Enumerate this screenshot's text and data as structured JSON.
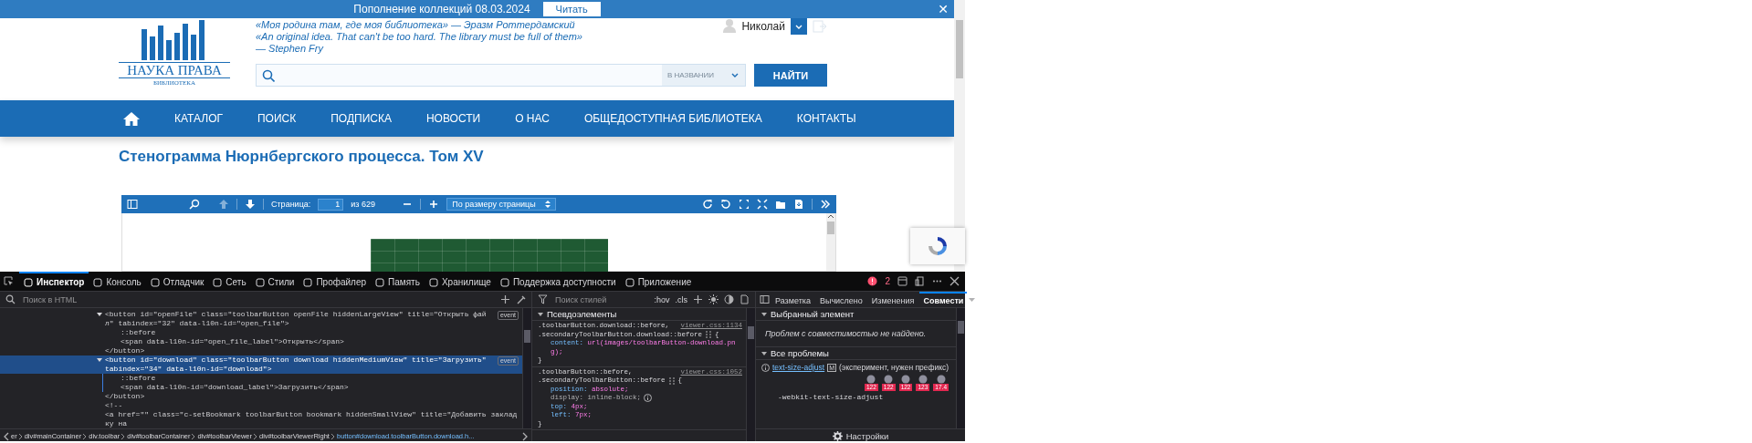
{
  "banner": {
    "text": "Пополнение коллекций 08.03.2024",
    "button": "Читать",
    "close": "✕"
  },
  "header": {
    "logo": {
      "title": "НАУКА ПРАВА",
      "subtitle": "БИБЛИОТЕКА"
    },
    "quotes": [
      "«Моя родина там, где моя библиотека» — Эразм Роттердамский",
      "«An original idea. That can't be too hard. The library must be full of them»",
      "— Stephen Fry"
    ],
    "user": {
      "name": "Николай"
    },
    "search": {
      "scope": "В НАЗВАНИИ",
      "button": "НАЙТИ"
    }
  },
  "nav": {
    "items": [
      {
        "kind": "home"
      },
      {
        "kind": "link",
        "label": "КАТАЛОГ"
      },
      {
        "kind": "link",
        "label": "ПОИСК"
      },
      {
        "kind": "link",
        "label": "ПОДПИСКА"
      },
      {
        "kind": "link",
        "label": "НОВОСТИ"
      },
      {
        "kind": "link",
        "label": "О НАС"
      },
      {
        "kind": "link",
        "label": "ОБЩЕДОСТУПНАЯ БИБЛИОТЕКА"
      },
      {
        "kind": "link",
        "label": "КОНТАКТЫ"
      }
    ]
  },
  "page_title": "Стенограмма Нюрнбергского процесса. Том XV",
  "pdf_viewer": {
    "previous_page": {
      "disabled": true
    },
    "next_page": {
      "disabled": false
    },
    "page_label": "Страница:",
    "page_number": "1",
    "page_count": "из 629",
    "zoom": "По размеру страницы"
  },
  "devtools": {
    "tabs": [
      {
        "label": "Инспектор",
        "selected": true
      },
      {
        "label": "Консоль",
        "selected": false
      },
      {
        "label": "Отладчик",
        "selected": false
      },
      {
        "label": "Сеть",
        "selected": false
      },
      {
        "label": "Стили",
        "selected": false
      },
      {
        "label": "Профайлер",
        "selected": false
      },
      {
        "label": "Память",
        "selected": false
      },
      {
        "label": "Хранилище",
        "selected": false
      },
      {
        "label": "Поддержка доступности",
        "selected": false
      },
      {
        "label": "Приложение",
        "selected": false
      }
    ],
    "error_count": "2",
    "html_search": {
      "placeholder": "Поиск в HTML"
    },
    "html_tree": [
      {
        "text": "<button id=\"openFile\" class=\"toolbarButton openFile hiddenLargeView\" title=\"Открыть файл\" tabindex=\"32\" data-l10n-id=\"open_file\">",
        "badge": "event",
        "expanded": true,
        "selected": false,
        "children": [
          {
            "text": "::before",
            "selected": false
          },
          {
            "text": "<span data-l10n-id=\"open_file_label\">Открыть</span>",
            "selected": false
          }
        ],
        "closing": "</button>"
      },
      {
        "text": "<button id=\"download\" class=\"toolbarButton download hiddenMediumView\" title=\"Загрузить\" tabindex=\"34\" data-l10n-id=\"download\">",
        "badge": "event",
        "expanded": true,
        "selected": true,
        "children": [
          {
            "text": "::before",
            "selected": false
          },
          {
            "text": "<span data-l10n-id=\"download_label\">Загрузить</span>",
            "selected": false
          }
        ],
        "closing": "</button>"
      },
      {
        "text": "<!--",
        "selected": false
      },
      {
        "text": "<a href=\"\" class=\"c-setBookmark toolbarButton bookmark hiddenSmallView\" title=\"Добавить закладку на",
        "selected": false
      }
    ],
    "breadcrumbs": [
      {
        "label": "er",
        "selected": false
      },
      {
        "label": "div#mainContainer",
        "selected": false
      },
      {
        "label": "div.toolbar",
        "selected": false
      },
      {
        "label": "div#toolbarContainer",
        "selected": false
      },
      {
        "label": "div#toolbarViewer",
        "selected": false
      },
      {
        "label": "div#toolbarViewerRight",
        "selected": false
      },
      {
        "label": "button#download.toolbarButton.download.h...",
        "selected": true
      }
    ],
    "styles_search": {
      "placeholder": "Поиск стилей"
    },
    "style_toggles": [
      ":hov",
      ".cls"
    ],
    "styles": {
      "section": "Псевдоэлементы",
      "expanded": true,
      "rules": [
        {
          "selectors": [
            ".toolbarButton.download::before,",
            ".secondaryToolbarButton.download::before"
          ],
          "source": "viewer.css:1134",
          "open": "{",
          "close": "}",
          "declarations": [
            {
              "name": "content:",
              "value": "url(images/toolbarButton-download.png);",
              "inactive": false
            }
          ]
        },
        {
          "selectors": [
            ".toolbarButton::before,",
            ".secondaryToolbarButton::before"
          ],
          "source": "viewer.css:1052",
          "open": "{",
          "close": "}",
          "declarations": [
            {
              "name": "position:",
              "value": "absolute;",
              "inactive": false
            },
            {
              "name": "display:",
              "value": "inline-block;",
              "inactive": true
            },
            {
              "name": "top:",
              "value": "4px;",
              "inactive": false
            },
            {
              "name": "left:",
              "value": "7px;",
              "inactive": false
            }
          ]
        }
      ]
    },
    "side_tabs": [
      {
        "label": "Разметка",
        "selected": false
      },
      {
        "label": "Вычислено",
        "selected": false
      },
      {
        "label": "Изменения",
        "selected": false
      },
      {
        "label": "Совмести",
        "selected": true
      }
    ],
    "compatibility": {
      "selected_section": "Выбранный элемент",
      "message": "Проблем с совместимостью не найдено.",
      "all_section": "Все проблемы",
      "issue": {
        "property": "text-size-adjust",
        "flag": "M",
        "note": "(эксперимент, нужен префикс)",
        "versions": [
          "122",
          "122",
          "122",
          "123",
          "17.4"
        ],
        "alias": "-webkit-text-size-adjust"
      }
    },
    "settings": "Настройки"
  }
}
